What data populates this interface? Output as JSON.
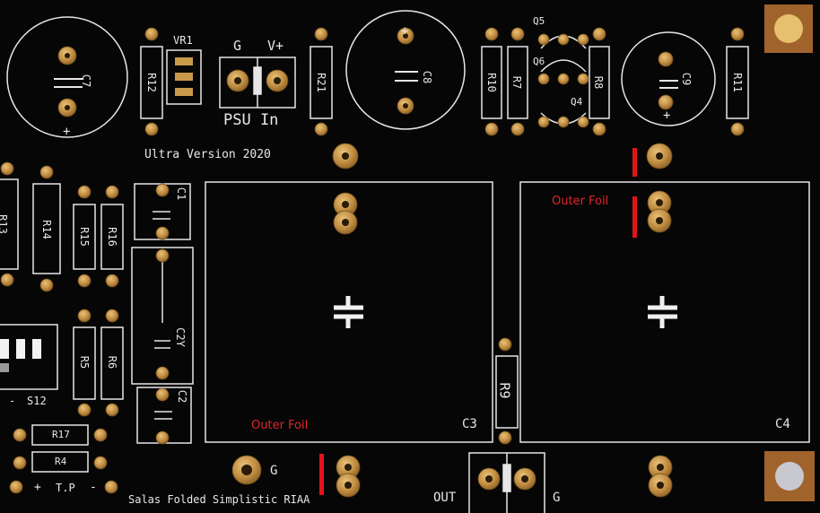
{
  "board": {
    "title": "Ultra Version 2020",
    "footer": "Salas Folded Simplistic RIAA",
    "psu": {
      "ground": "G",
      "positive": "V+",
      "label": "PSU In"
    },
    "output": {
      "label": "OUT",
      "ground": "G"
    },
    "ground_pad": "G",
    "test_point": {
      "plus": "+",
      "label": "T.P",
      "minus": "-"
    },
    "switch": {
      "minus": "-",
      "label": "S12"
    },
    "plus_sign": "+",
    "colors": {
      "board": "#060606",
      "silkscreen": "#e8e8e8",
      "pad_gold": "#c89a4a",
      "note_red": "#e1242a",
      "mount_copper": "#a0632c"
    }
  },
  "refs": {
    "c7": "C7",
    "vr1": "VR1",
    "r12": "R12",
    "r21": "R21",
    "c8": "C8",
    "r10": "R10",
    "r7": "R7",
    "q5": "Q5",
    "q6": "Q6",
    "q4": "Q4",
    "r8": "R8",
    "c9": "C9",
    "r11": "R11",
    "r13": "R13",
    "r14": "R14",
    "r15": "R15",
    "r16": "R16",
    "c1": "C1",
    "c2y": "C2Y",
    "c2": "C2",
    "r5": "R5",
    "r6": "R6",
    "r17": "R17",
    "r4": "R4",
    "r9": "R9",
    "c3": "C3",
    "c4": "C4"
  },
  "annotations": {
    "outer_foil_top": "Outer Foil",
    "outer_foil_bottom": "Outer Foil"
  }
}
